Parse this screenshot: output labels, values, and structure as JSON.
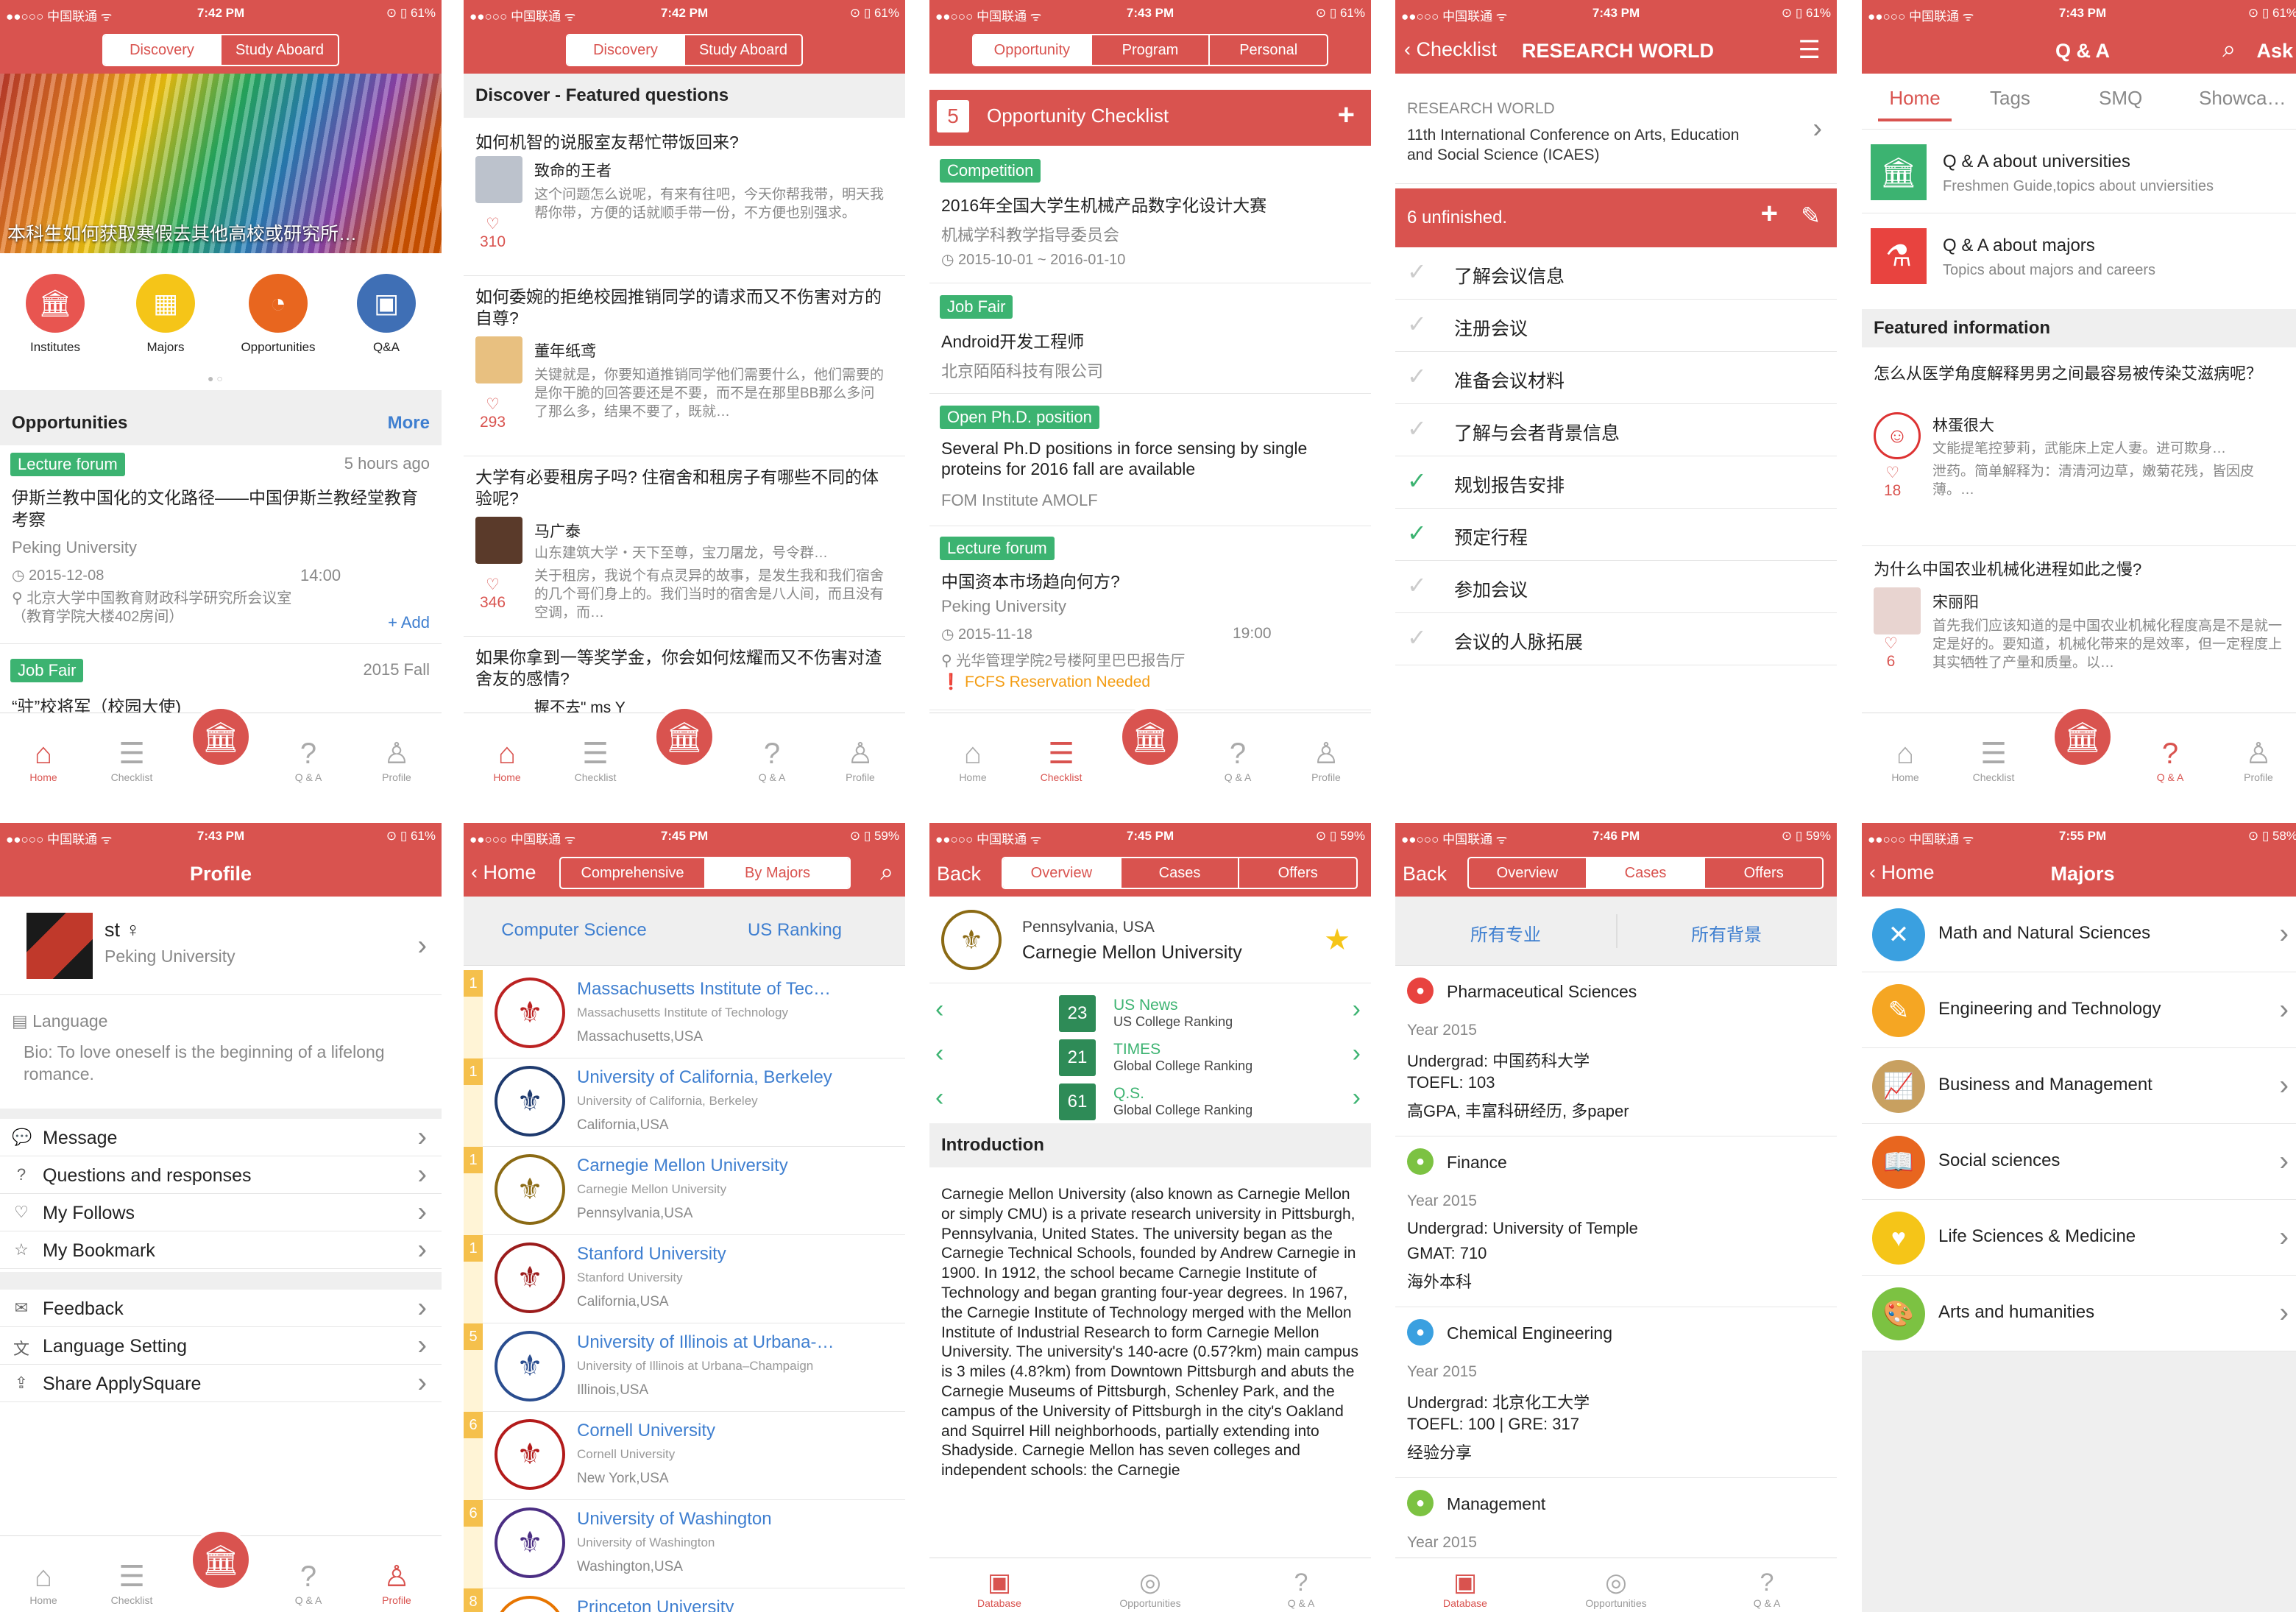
{
  "status": {
    "carrier": "●●○○○ 中国联通 ᯤ",
    "times": [
      "7:42 PM",
      "7:42 PM",
      "7:43 PM",
      "7:43 PM",
      "7:43 PM",
      "7:43 PM",
      "7:45 PM",
      "7:45 PM",
      "7:46 PM",
      "7:55 PM"
    ],
    "batt": [
      "61%",
      "61%",
      "61%",
      "61%",
      "61%",
      "61%",
      "59%",
      "59%",
      "59%",
      "58%"
    ]
  },
  "tabbar": {
    "home": "Home",
    "checklist": "Checklist",
    "qa": "Q & A",
    "profile": "Profile",
    "database": "Database",
    "opportunities": "Opportunities"
  },
  "s1": {
    "seg": [
      "Discovery",
      "Study Aboard"
    ],
    "banner": "本科生如何获取寒假去其他高校或研究所…",
    "icons": [
      {
        "label": "Institutes",
        "color": "#e85550"
      },
      {
        "label": "Majors",
        "color": "#f5c518"
      },
      {
        "label": "Opportunities",
        "color": "#e8661f"
      },
      {
        "label": "Q&A",
        "color": "#3f6fb5"
      }
    ],
    "opp_title": "Opportunities",
    "more": "More",
    "item1": {
      "tag": "Lecture forum",
      "ago": "5 hours ago",
      "title": "伊斯兰教中国化的文化路径——中国伊斯兰教经堂教育考察",
      "org": "Peking University",
      "date": "2015-12-08",
      "time": "14:00",
      "loc": "北京大学中国教育财政科学研究所会议室（教育学院大楼402房间）",
      "add": "+ Add"
    },
    "item2": {
      "tag": "Job Fair",
      "ago": "2015 Fall",
      "title": "“驻”校将军（校园大使)"
    }
  },
  "s2": {
    "seg": [
      "Discovery",
      "Study Aboard"
    ],
    "header": "Discover - Featured questions",
    "qs": [
      {
        "q": "如何机智的说服室友帮忙带饭回来?",
        "user": "致命的王者",
        "text": "这个问题怎么说呢，有来有往吧，今天你帮我带，明天我帮你带，方便的话就顺手带一份，不方便也别强求。",
        "likes": "310"
      },
      {
        "q": "如何委婉的拒绝校园推销同学的请求而又不伤害对方的自尊?",
        "user": "董年纸鸢",
        "text": "关键就是，你要知道推销同学他们需要什么，他们需要的是你干脆的回答要还是不要，而不是在那里BB那么多问了那么多，结果不要了，既就…",
        "likes": "293"
      },
      {
        "q": "大学有必要租房子吗? 住宿舍和租房子有哪些不同的体验呢?",
        "user": "马广泰",
        "sub": "山东建筑大学・天下至尊，宝刀屠龙，号令群…",
        "text": "关于租房，我说个有点灵异的故事，是发生我和我们宿舍的几个哥们身上的。我们当时的宿舍是八人间，而且没有空调，而…",
        "likes": "346"
      },
      {
        "q": "如果你拿到一等奖学金，你会如何炫耀而又不伤害对渣舍友的感情?",
        "user": "握不去\" ms Y"
      }
    ]
  },
  "s3": {
    "seg": [
      "Opportunity",
      "Program",
      "Personal"
    ],
    "num": "5",
    "title": "Opportunity Checklist",
    "plus": "+",
    "items": [
      {
        "tag": "Competition",
        "title": "2016年全国大学生机械产品数字化设计大赛",
        "org": "机械学科教学指导委员会",
        "date": "2015-10-01 ~ 2016-01-10"
      },
      {
        "tag": "Job Fair",
        "title": "Android开发工程师",
        "org": "北京陌陌科技有限公司"
      },
      {
        "tag": "Open Ph.D. position",
        "title": "Several Ph.D positions in  force sensing by single proteins for 2016 fall are available",
        "org": "FOM Institute AMOLF"
      },
      {
        "tag": "Lecture forum",
        "title": "中国资本市场趋向何方?",
        "org": "Peking University",
        "date": "2015-11-18",
        "time": "19:00",
        "loc": "光华管理学院2号楼阿里巴巴报告厅",
        "warn": "FCFS Reservation Needed"
      }
    ]
  },
  "s4": {
    "back": "Checklist",
    "title": "RESEARCH WORLD",
    "org": "RESEARCH WORLD",
    "conf": "11th International Conference on Arts, Education and Social Science (ICAES)",
    "unfinished": "6 unfinished.",
    "tasks": [
      "了解会议信息",
      "注册会议",
      "准备会议材料",
      "了解与会者背景信息",
      "规划报告安排",
      "预定行程",
      "参加会议",
      "会议的人脉拓展"
    ],
    "done": [
      false,
      false,
      false,
      false,
      true,
      true,
      false,
      false
    ]
  },
  "s5": {
    "title": "Q & A",
    "ask": "Ask",
    "tabs": [
      "Home",
      "Tags",
      "SMQ",
      "Showca…"
    ],
    "cats": [
      {
        "t": "Q & A about universities",
        "s": "Freshmen Guide,topics about unviersities",
        "color": "#3cb371",
        "icon": "🏛"
      },
      {
        "t": "Q & A about majors",
        "s": "Topics about majors and careers",
        "color": "#e8433f",
        "icon": "⚗"
      }
    ],
    "featured": "Featured information",
    "qs": [
      {
        "q": "怎么从医学角度解释男男之间最容易被传染艾滋病呢？",
        "user": "林蛋很大",
        "sub": "文能提笔控萝莉，武能床上定人妻。进可欺身…",
        "text": "泄药。简单解释为：清清河边草，嫩菊花残，皆因皮薄。…",
        "likes": "18"
      },
      {
        "q": "为什么中国农业机械化进程如此之慢?",
        "user": "宋丽阳",
        "text": "首先我们应该知道的是中国农业机械化程度高是不是就一定是好的。要知道，机械化带来的是效率，但一定程度上其实牺牲了产量和质量。以…",
        "likes": "6"
      }
    ]
  },
  "s6": {
    "title": "Profile",
    "name": "st ♀",
    "school": "Peking University",
    "lang": "Language",
    "bio": "Bio: To love oneself is the beginning of a lifelong romance.",
    "menu1": [
      {
        "t": "Message",
        "i": "💬"
      },
      {
        "t": "Questions and responses",
        "i": "?"
      },
      {
        "t": "My Follows",
        "i": "♡"
      },
      {
        "t": "My Bookmark",
        "i": "☆"
      }
    ],
    "menu2": [
      {
        "t": "Feedback",
        "i": "✉"
      },
      {
        "t": "Language Setting",
        "i": "文"
      },
      {
        "t": "Share ApplySquare",
        "i": "⇪"
      }
    ]
  },
  "s7": {
    "back": "Home",
    "seg": [
      "Comprehensive",
      "By Majors"
    ],
    "f1": "Computer Science",
    "f2": "US Ranking",
    "unis": [
      {
        "rank": "1",
        "name": "Massachusetts Institute of Tec…",
        "sub": "Massachusetts Institute of Technology",
        "loc": "Massachusetts,USA",
        "color": "#b22"
      },
      {
        "rank": "1",
        "name": "University of California, Berkeley",
        "sub": "University of California, Berkeley",
        "loc": "California,USA",
        "color": "#1e3a6e"
      },
      {
        "rank": "1",
        "name": "Carnegie Mellon University",
        "sub": "Carnegie Mellon University",
        "loc": "Pennsylvania,USA",
        "color": "#8b6a14"
      },
      {
        "rank": "1",
        "name": "Stanford University",
        "sub": "Stanford University",
        "loc": "California,USA",
        "color": "#9b1c1c"
      },
      {
        "rank": "5",
        "name": "University of Illinois at Urbana-…",
        "sub": "University of Illinois at Urbana–Champaign",
        "loc": "Illinois,USA",
        "color": "#2a4d8f"
      },
      {
        "rank": "6",
        "name": "Cornell University",
        "sub": "Cornell University",
        "loc": "New York,USA",
        "color": "#b31b1b"
      },
      {
        "rank": "6",
        "name": "University of Washington",
        "sub": "University of Washington",
        "loc": "Washington,USA",
        "color": "#4b2e83"
      },
      {
        "rank": "8",
        "name": "Princeton University",
        "sub": "",
        "loc": "",
        "color": "#e77500"
      }
    ]
  },
  "s8": {
    "back": "Back",
    "seg": [
      "Overview",
      "Cases",
      "Offers"
    ],
    "loc": "Pennsylvania, USA",
    "name": "Carnegie Mellon University",
    "ranks": [
      {
        "n": "23",
        "a": "US News",
        "b": "US College Ranking"
      },
      {
        "n": "21",
        "a": "TIMES",
        "b": "Global College Ranking"
      },
      {
        "n": "61",
        "a": "Q.S.",
        "b": "Global College Ranking"
      }
    ],
    "intro": "Introduction",
    "text": "Carnegie Mellon University (also known as Carnegie Mellon or simply CMU) is a private research university in Pittsburgh, Pennsylvania, United States. The university began as the Carnegie Technical Schools, founded by Andrew Carnegie in 1900. In 1912, the school became Carnegie Institute of Technology and began granting four-year degrees. In 1967, the Carnegie Institute of Technology merged with the Mellon Institute of Industrial Research to form Carnegie Mellon University. The university's 140-acre (0.57?km) main campus is 3 miles (4.8?km) from Downtown Pittsburgh and abuts the Carnegie Museums of Pittsburgh, Schenley Park, and the campus of the University of Pittsburgh in the city's Oakland and Squirrel Hill neighborhoods, partially extending into Shadyside. Carnegie Mellon has seven colleges and independent schools: the Carnegie"
  },
  "s9": {
    "back": "Back",
    "seg": [
      "Overview",
      "Cases",
      "Offers"
    ],
    "f1": "所有专业",
    "f2": "所有背景",
    "cases": [
      {
        "major": "Pharmaceutical Sciences",
        "color": "#e8433f",
        "year": "Year 2015",
        "l1": "Undergrad: 中国药科大学",
        "l2": "TOEFL: 103",
        "l3": "高GPA, 丰富科研经历, 多paper"
      },
      {
        "major": "Finance",
        "color": "#7cc242",
        "year": "Year 2015",
        "l1": "Undergrad: University of Temple",
        "l2": "GMAT: 710",
        "l3": "海外本科"
      },
      {
        "major": "Chemical Engineering",
        "color": "#3aa0e0",
        "year": "Year 2015",
        "l1": "Undergrad: 北京化工大学",
        "l2": "TOEFL: 100  |  GRE: 317",
        "l3": "经验分享"
      },
      {
        "major": "Management",
        "color": "#7cc242",
        "year": "Year 2015",
        "l1": "",
        "l2": "",
        "l3": ""
      }
    ]
  },
  "s10": {
    "back": "Home",
    "title": "Majors",
    "majors": [
      {
        "t": "Math and Natural Sciences",
        "c": "#3aa0e0",
        "i": "✕"
      },
      {
        "t": "Engineering and Technology",
        "c": "#f5a623",
        "i": "✎"
      },
      {
        "t": "Business and Management",
        "c": "#c8a060",
        "i": "📈"
      },
      {
        "t": "Social sciences",
        "c": "#e8661f",
        "i": "📖"
      },
      {
        "t": "Life Sciences & Medicine",
        "c": "#f5c518",
        "i": "♥"
      },
      {
        "t": "Arts and humanities",
        "c": "#7cc242",
        "i": "🎨"
      }
    ]
  }
}
